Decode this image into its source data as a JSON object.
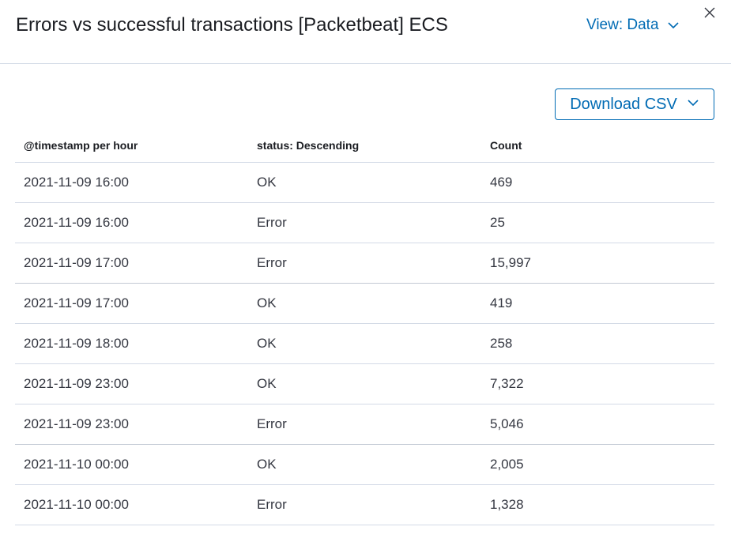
{
  "header": {
    "title": "Errors vs successful transactions [Packetbeat] ECS",
    "view_label": "View: Data"
  },
  "toolbar": {
    "download_label": "Download CSV"
  },
  "table": {
    "columns": [
      "@timestamp per hour",
      "status: Descending",
      "Count"
    ],
    "rows": [
      [
        "2021-11-09 16:00",
        "OK",
        "469"
      ],
      [
        "2021-11-09 16:00",
        "Error",
        "25"
      ],
      [
        "2021-11-09 17:00",
        "Error",
        "15,997"
      ],
      [
        "2021-11-09 17:00",
        "OK",
        "419"
      ],
      [
        "2021-11-09 18:00",
        "OK",
        "258"
      ],
      [
        "2021-11-09 23:00",
        "OK",
        "7,322"
      ],
      [
        "2021-11-09 23:00",
        "Error",
        "5,046"
      ],
      [
        "2021-11-10 00:00",
        "OK",
        "2,005"
      ],
      [
        "2021-11-10 00:00",
        "Error",
        "1,328"
      ]
    ]
  },
  "icons": {
    "view_toggle": "chevron-down-icon",
    "download": "chevron-down-icon",
    "close": "close-icon"
  },
  "colors": {
    "accent": "#006bb4",
    "text": "#343741",
    "heading": "#1a1c21",
    "border": "#d3dae6"
  }
}
